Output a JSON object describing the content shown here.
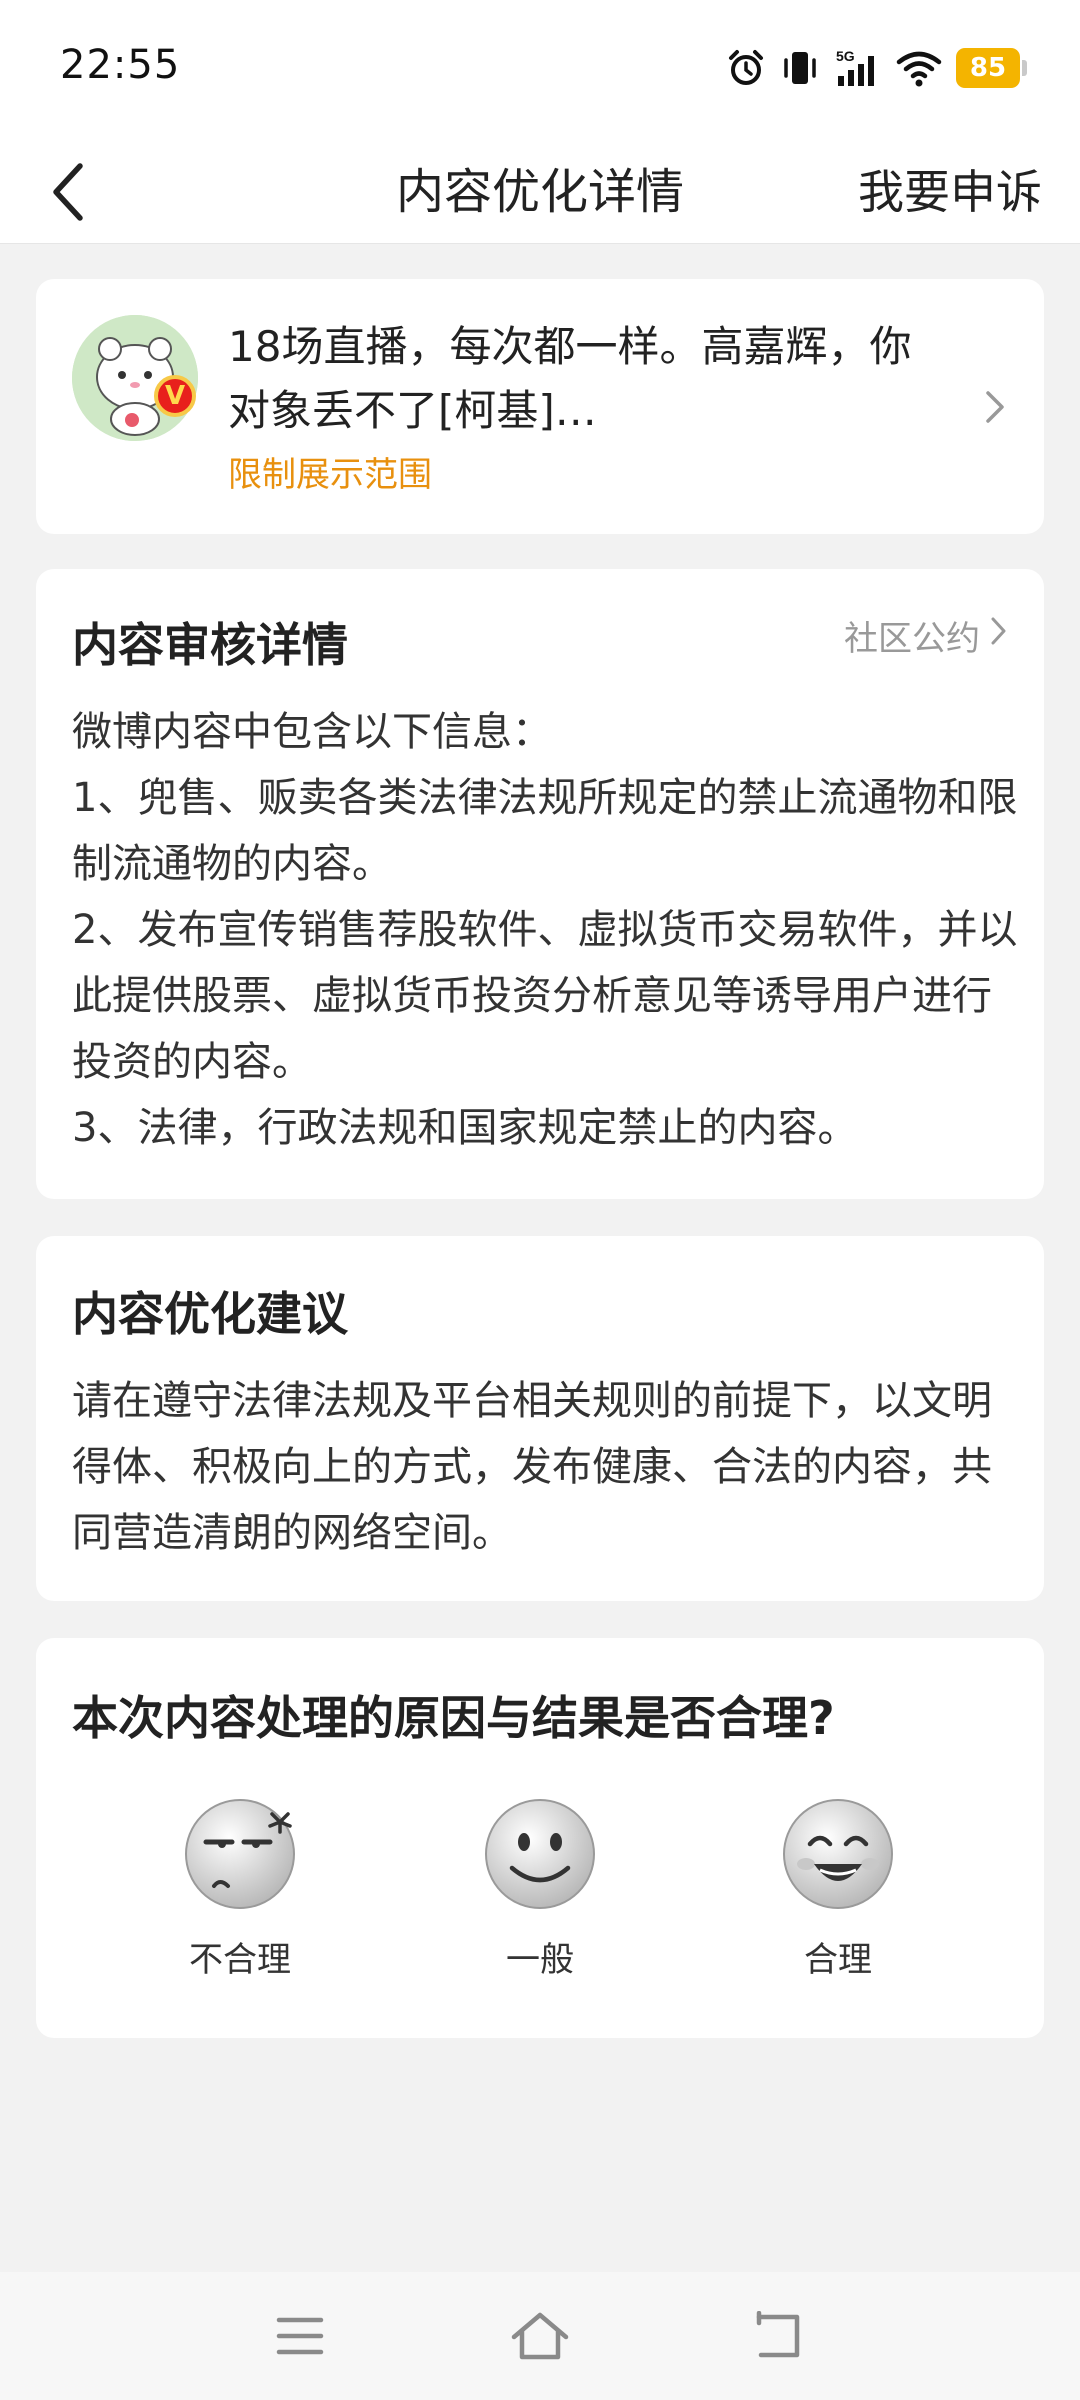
{
  "status_bar": {
    "time": "22:55",
    "network": "5G",
    "battery": "85",
    "icons": [
      "alarm-icon",
      "vibrate-icon",
      "signal-icon",
      "wifi-icon",
      "battery-icon"
    ]
  },
  "header": {
    "title": "内容优化详情",
    "appeal_label": "我要申诉",
    "back_icon": "back-arrow-icon"
  },
  "post": {
    "text": "18场直播，每次都一样。高嘉辉，你对象丢不了[柯基]…",
    "status": "限制展示范围",
    "badge": "V"
  },
  "review": {
    "title": "内容审核详情",
    "rules_link": "社区公约",
    "intro": "微博内容中包含以下信息：",
    "items": [
      "1、兜售、贩卖各类法律法规所规定的禁止流通物和限制流通物的内容。",
      "2、发布宣传销售荐股软件、虚拟货币交易软件，并以此提供股票、虚拟货币投资分析意见等诱导用户进行投资的内容。",
      "3、法律，行政法规和国家规定禁止的内容。"
    ]
  },
  "suggestion": {
    "title": "内容优化建议",
    "body": "请在遵守法律法规及平台相关规则的前提下，以文明得体、积极向上的方式，发布健康、合法的内容，共同营造清朗的网络空间。"
  },
  "feedback": {
    "question": "本次内容处理的原因与结果是否合理?",
    "options": [
      {
        "label": "不合理",
        "icon": "annoyed-face-icon"
      },
      {
        "label": "一般",
        "icon": "neutral-face-icon"
      },
      {
        "label": "合理",
        "icon": "happy-face-icon"
      }
    ]
  },
  "colors": {
    "accent_orange": "#e8900e",
    "battery_yellow": "#f4b400",
    "badge_red": "#e8201c"
  }
}
